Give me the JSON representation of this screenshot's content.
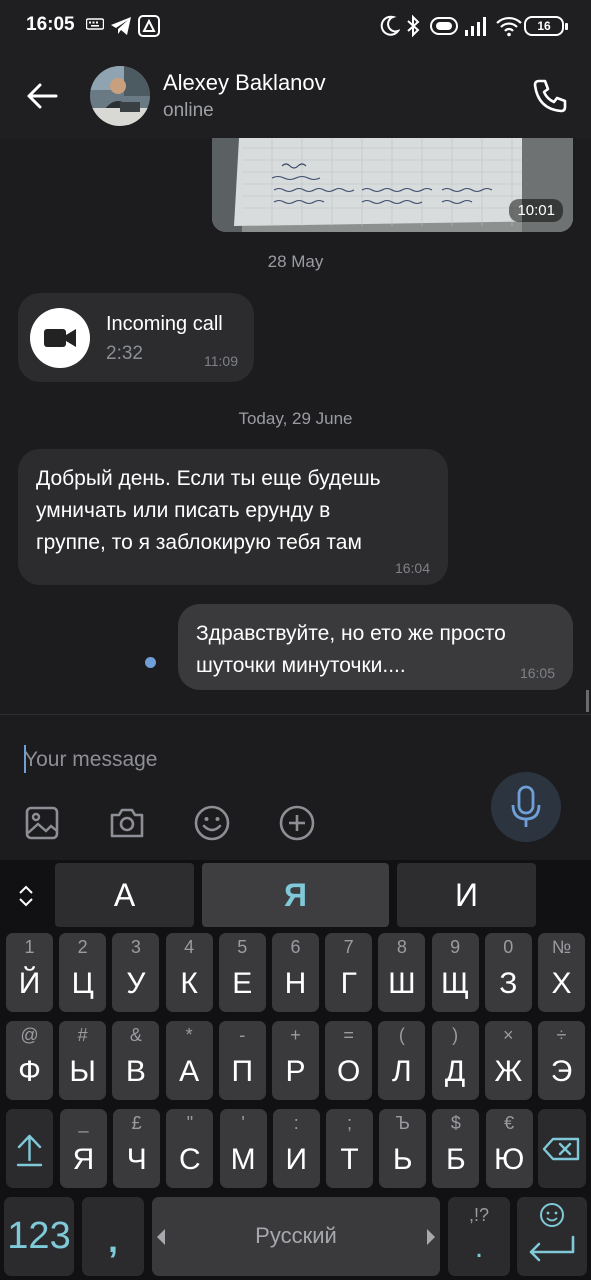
{
  "status_bar": {
    "time": "16:05",
    "battery": "16"
  },
  "header": {
    "contact_name": "Alexey Baklanov",
    "contact_status": "online"
  },
  "chat": {
    "photo_message": {
      "time": "10:01"
    },
    "date_separators": [
      "28 May",
      "Today, 29 June"
    ],
    "call_message": {
      "title": "Incoming call",
      "duration": "2:32",
      "time": "11:09"
    },
    "incoming_message": {
      "lines": [
        "Добрый день. Если ты еще будешь",
        "умничать или писать ерунду в",
        "группе, то я заблокирую тебя там"
      ],
      "time": "16:04"
    },
    "outgoing_message": {
      "lines": [
        "Здравствуйте, но ето же просто",
        "шуточки минуточки...."
      ],
      "time": "16:05"
    }
  },
  "composer": {
    "placeholder": "Your message",
    "value": ""
  },
  "keyboard": {
    "suggestions": [
      "А",
      "Я",
      "И"
    ],
    "rows": [
      [
        {
          "hint": "1",
          "main": "Й"
        },
        {
          "hint": "2",
          "main": "Ц"
        },
        {
          "hint": "3",
          "main": "У"
        },
        {
          "hint": "4",
          "main": "К"
        },
        {
          "hint": "5",
          "main": "Е"
        },
        {
          "hint": "6",
          "main": "Н"
        },
        {
          "hint": "7",
          "main": "Г"
        },
        {
          "hint": "8",
          "main": "Ш"
        },
        {
          "hint": "9",
          "main": "Щ"
        },
        {
          "hint": "0",
          "main": "З"
        },
        {
          "hint": "№",
          "main": "Х"
        }
      ],
      [
        {
          "hint": "@",
          "main": "Ф"
        },
        {
          "hint": "#",
          "main": "Ы"
        },
        {
          "hint": "&",
          "main": "В"
        },
        {
          "hint": "*",
          "main": "А"
        },
        {
          "hint": "-",
          "main": "П"
        },
        {
          "hint": "+",
          "main": "Р"
        },
        {
          "hint": "=",
          "main": "О"
        },
        {
          "hint": "(",
          "main": "Л"
        },
        {
          "hint": ")",
          "main": "Д"
        },
        {
          "hint": "×",
          "main": "Ж"
        },
        {
          "hint": "÷",
          "main": "Э"
        }
      ],
      [
        {
          "hint": "_",
          "main": "Я"
        },
        {
          "hint": "£",
          "main": "Ч"
        },
        {
          "hint": "\"",
          "main": "С"
        },
        {
          "hint": "'",
          "main": "М"
        },
        {
          "hint": ":",
          "main": "И"
        },
        {
          "hint": ";",
          "main": "Т"
        },
        {
          "hint": "Ъ",
          "main": "Ь"
        },
        {
          "hint": "$",
          "main": "Б"
        },
        {
          "hint": "€",
          "main": "Ю"
        }
      ]
    ],
    "key_123": "123",
    "key_comma": ",",
    "space_label": "Русский",
    "dot_hint": ",!?",
    "dot_main": "."
  },
  "colors": {
    "accent": "#6f9fd6",
    "keyboard_accent": "#7fc9d8",
    "bubble_in": "#2c2c2e",
    "bubble_out": "#3a3a3c"
  }
}
